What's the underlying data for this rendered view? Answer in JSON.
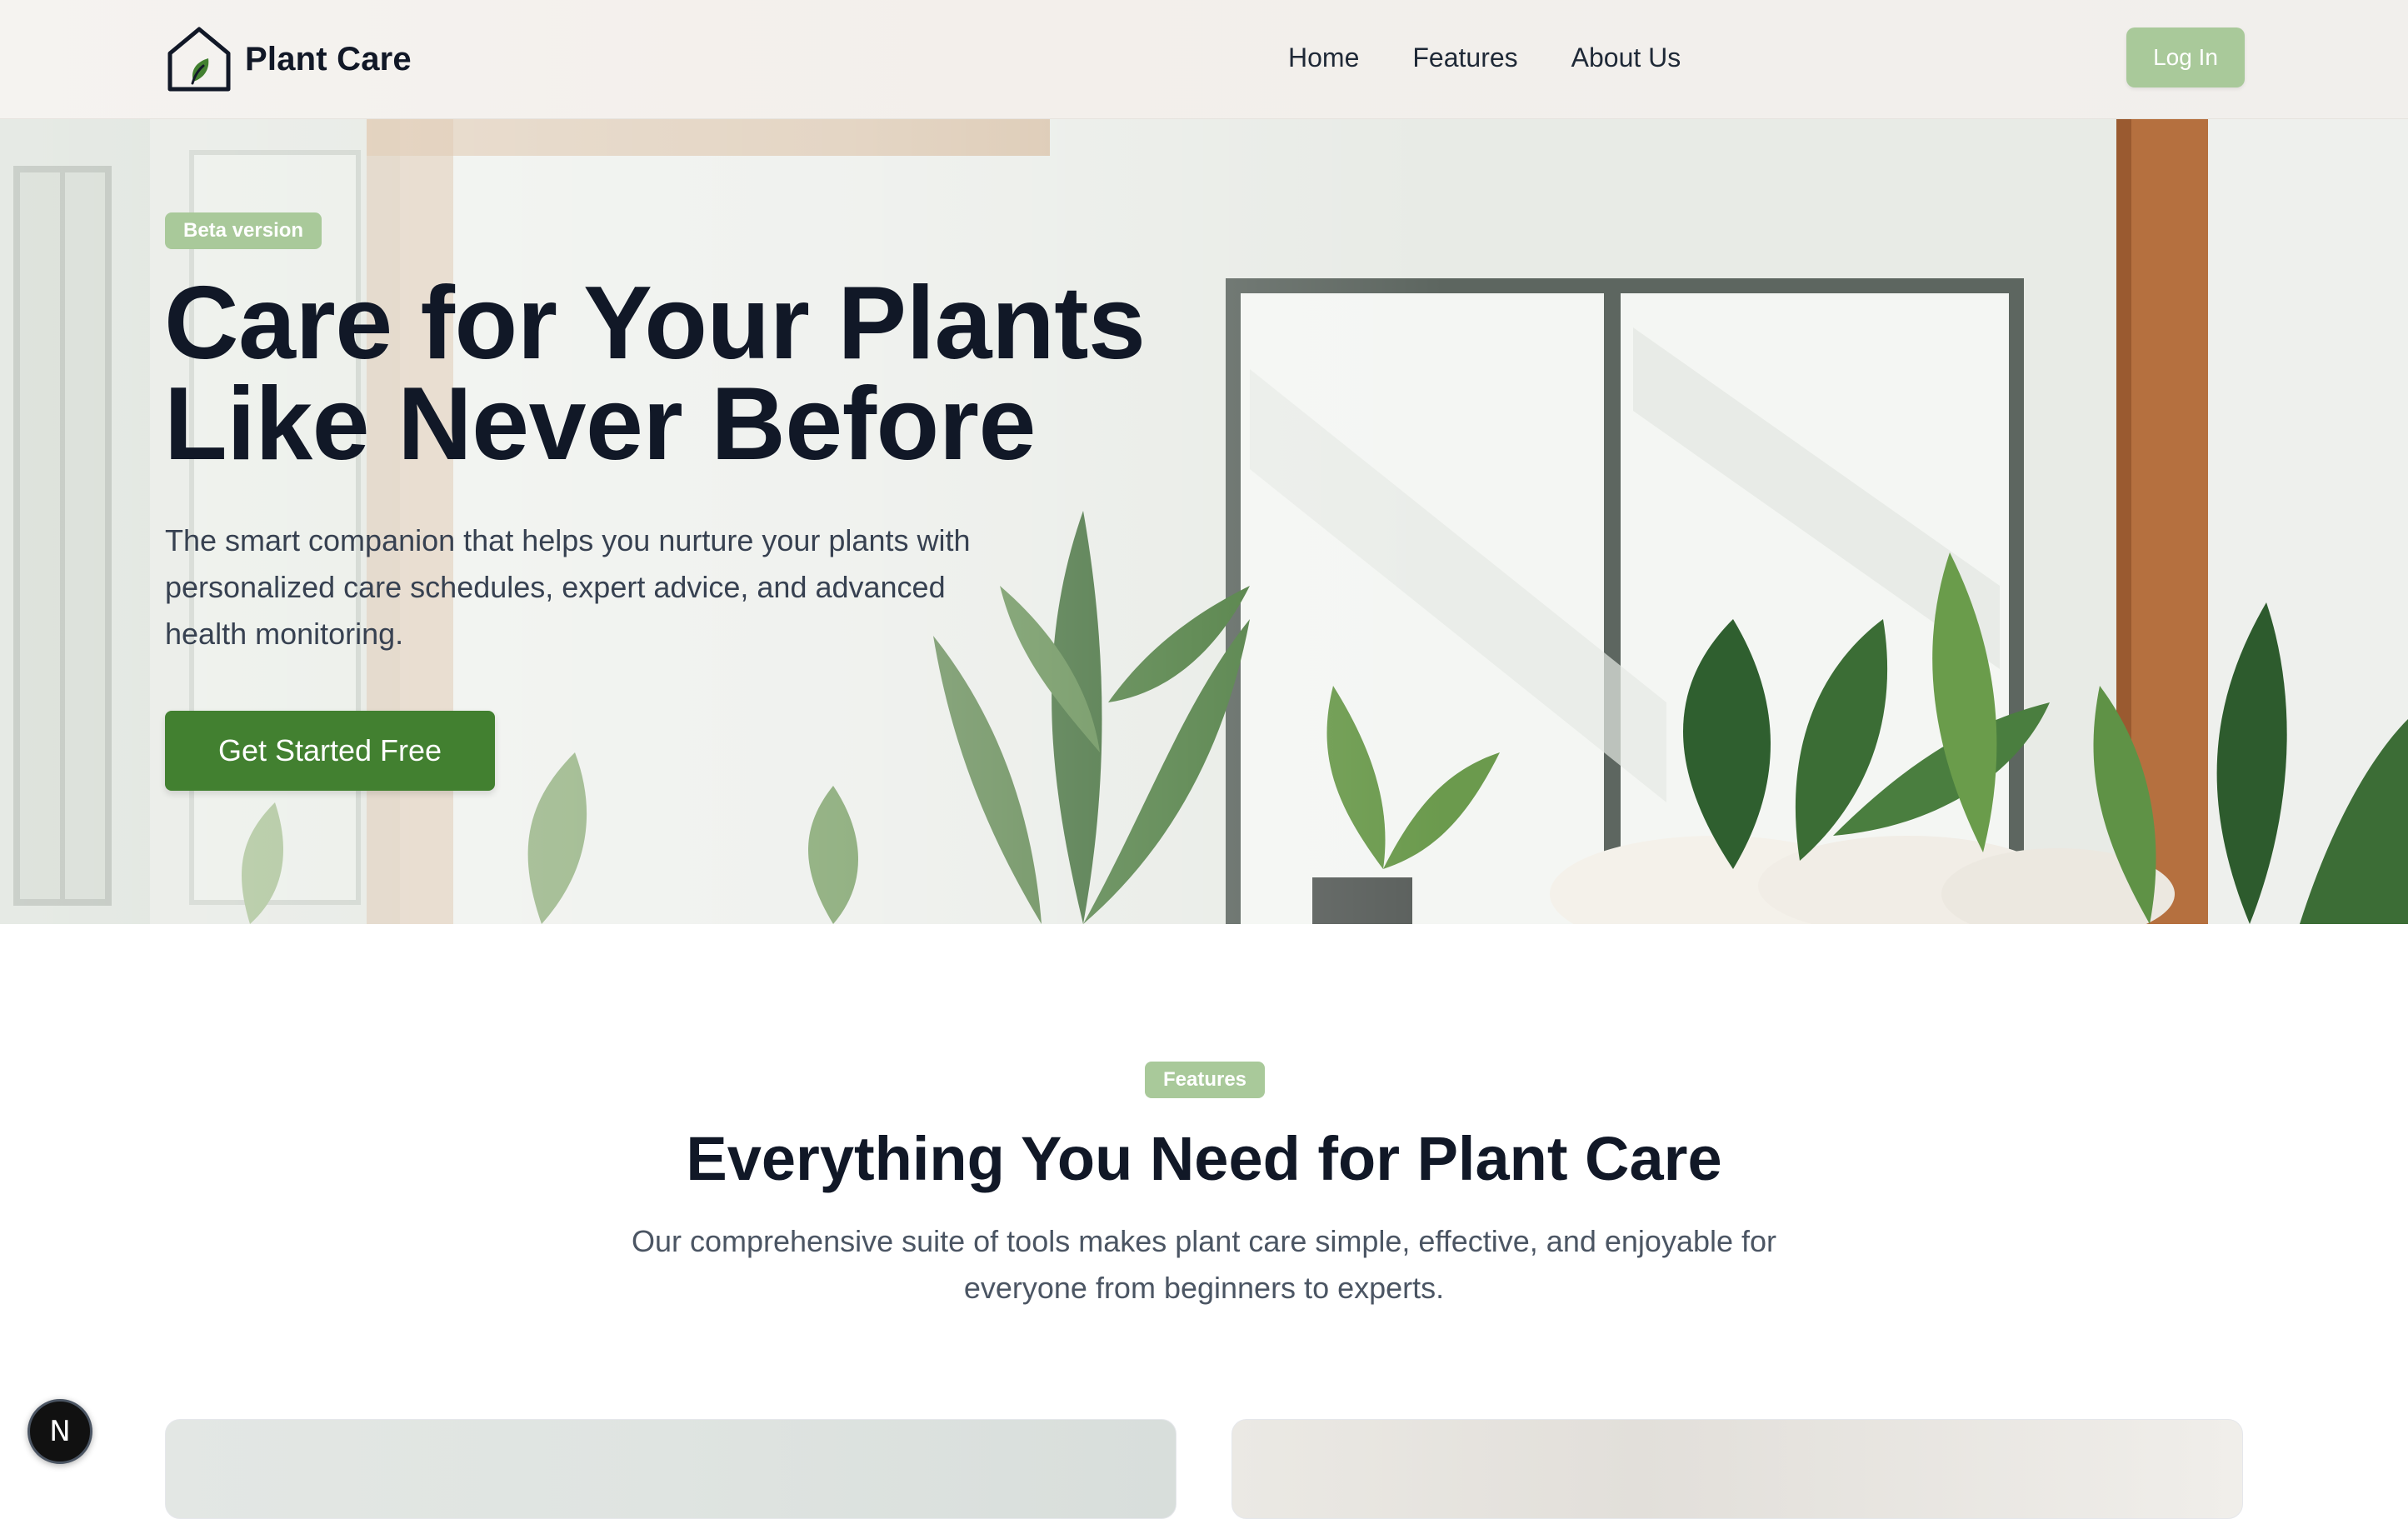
{
  "brand": {
    "name": "Plant Care",
    "icon": "house-leaf-icon"
  },
  "nav": {
    "items": [
      {
        "label": "Home"
      },
      {
        "label": "Features"
      },
      {
        "label": "About Us"
      }
    ],
    "login_label": "Log In"
  },
  "hero": {
    "badge": "Beta version",
    "title_line1": "Care for Your Plants",
    "title_line2": "Like Never Before",
    "subtitle": "The smart companion that helps you nurture your plants with personalized care schedules, expert advice, and advanced health monitoring.",
    "cta_label": "Get Started Free",
    "background": "living-room-with-plants-photo"
  },
  "features": {
    "badge": "Features",
    "title": "Everything You Need for Plant Care",
    "subtitle": "Our comprehensive suite of tools makes plant care simple, effective, and enjoyable for everyone from beginners to experts."
  },
  "dev_indicator": {
    "glyph": "N"
  },
  "colors": {
    "accent_green": "#428030",
    "badge_green": "#a9c99a",
    "heading": "#111827",
    "body_text": "#374151"
  }
}
